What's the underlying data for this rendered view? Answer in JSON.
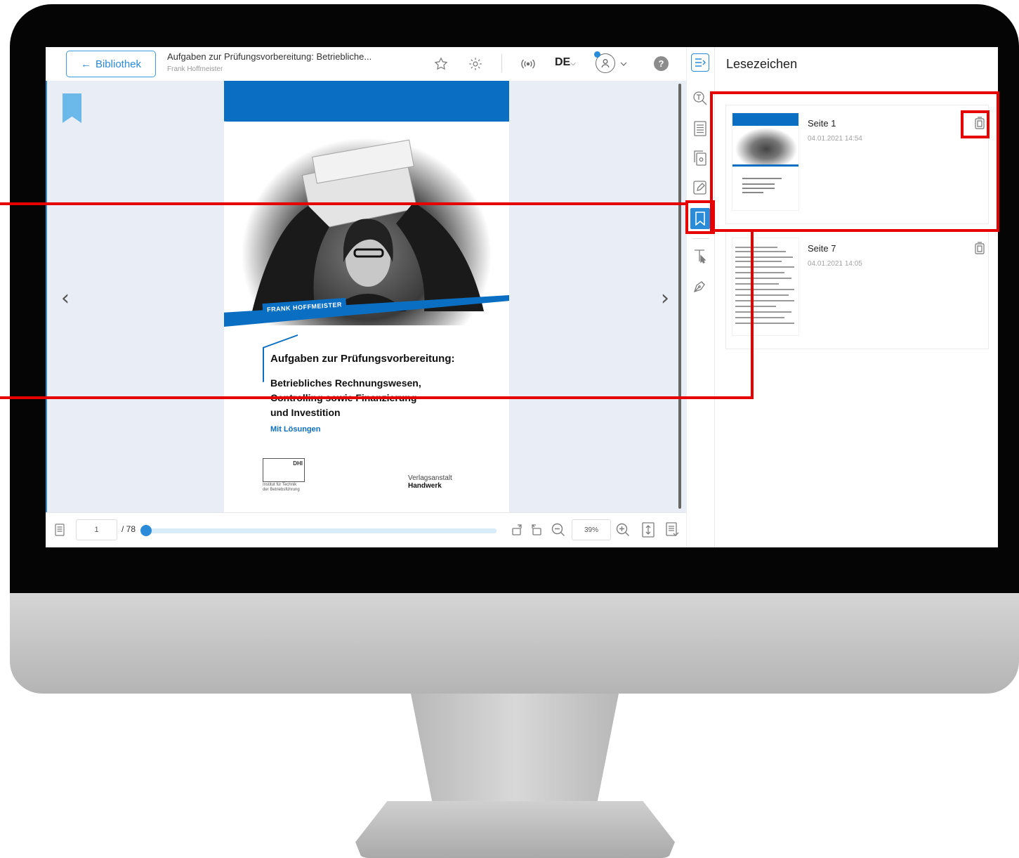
{
  "header": {
    "back_label": "Bibliothek",
    "back_arrow": "←",
    "doc_title": "Aufgaben zur Prüfungsvorbereitung: Betriebliche...",
    "doc_author": "Frank Hoffmeister",
    "lang_label": "DE",
    "lang_chevron": "⌵",
    "help_label": "?"
  },
  "book_cover": {
    "author_tag": "FRANK HOFFMEISTER",
    "heading": "Aufgaben zur Prüfungsvorbereitung:",
    "subheading_line1": "Betriebliches Rechnungswesen,",
    "subheading_line2": "Controlling sowie Finanzierung",
    "subheading_line3": "und Investition",
    "note": "Mit Lösungen",
    "dhi_logo": "DHI",
    "dhi_caption_line1": "Institut für Technik",
    "dhi_caption_line2": "der Betriebsführung",
    "publisher_line1": "Verlagsanstalt",
    "publisher_line2": "Handwerk"
  },
  "navigation": {
    "prev": "‹",
    "next": "›"
  },
  "footer": {
    "current_page": "1",
    "total_pages": "/ 78",
    "progress_fraction": 0.0,
    "zoom": "39%"
  },
  "panel": {
    "title": "Lesezeichen",
    "bookmarks": [
      {
        "label": "Seite 1",
        "date": "04.01.2021 14:54"
      },
      {
        "label": "Seite 7",
        "date": "04.01.2021 14:05"
      }
    ]
  },
  "icons": {
    "tools": [
      "panel-toggle-icon",
      "search-text-icon",
      "toc-icon",
      "thumbnails-icon",
      "notes-icon",
      "bookmark-icon",
      "text-select-icon",
      "pen-icon"
    ],
    "header": [
      "star-icon",
      "gear-icon",
      "audio-icon",
      "user-icon",
      "chevron-down-icon",
      "help-icon"
    ],
    "footer": [
      "page-list-icon",
      "rotate-right-icon",
      "rotate-left-icon",
      "zoom-out-icon",
      "zoom-in-icon",
      "fit-height-icon",
      "document-icon"
    ]
  },
  "colors": {
    "accent": "#2a8bd8",
    "book_blue": "#0a6fc2",
    "highlight": "#e60000",
    "viewer_bg": "#e9edf6"
  }
}
